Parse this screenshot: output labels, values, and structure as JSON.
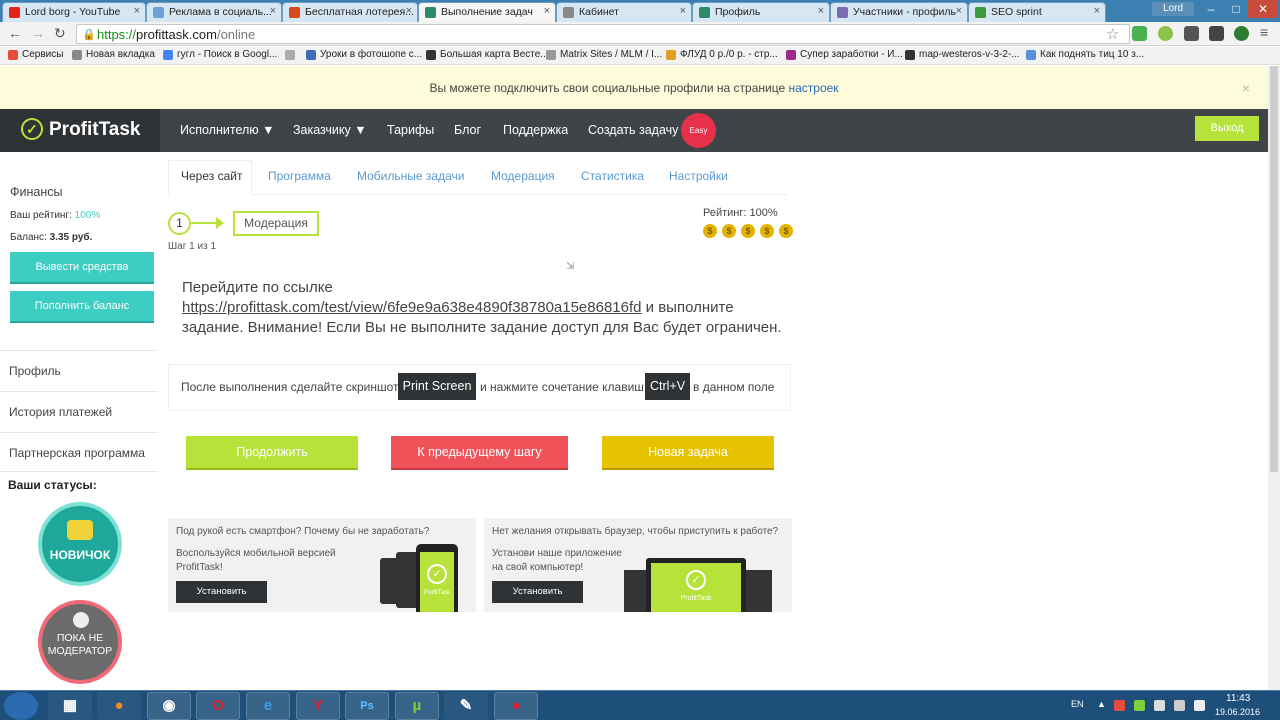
{
  "browser": {
    "tabs": [
      {
        "title": "Lord borg - YouTube",
        "color": "#e62117"
      },
      {
        "title": "Реклама в социаль...",
        "color": "#6aa1d6"
      },
      {
        "title": "Бесплатная лотерея...",
        "color": "#d84a1b"
      },
      {
        "title": "Выполнение задач",
        "color": "#2c8a6a"
      },
      {
        "title": "Кабинет",
        "color": "#888888"
      },
      {
        "title": "Профиль",
        "color": "#2c8a6a"
      },
      {
        "title": "Участники - профиль",
        "color": "#7a6bb2"
      },
      {
        "title": "SEO sprint",
        "color": "#3a9b3a"
      }
    ],
    "user_chip": "Lord",
    "url_scheme": "https://",
    "url_host": "profittask.com",
    "url_path": "/online",
    "bookmarks": [
      {
        "label": "Сервисы",
        "color": "#e74c3c"
      },
      {
        "label": "Новая вкладка",
        "color": "#888888"
      },
      {
        "label": "гугл - Поиск в Googl...",
        "color": "#4285f4"
      },
      {
        "label": "",
        "color": "#aaaaaa"
      },
      {
        "label": "Уроки в фотошопе с...",
        "color": "#3b6cb5"
      },
      {
        "label": "Большая карта Весте...",
        "color": "#333333"
      },
      {
        "label": "Matrix Sites / MLM / I...",
        "color": "#999999"
      },
      {
        "label": "ФЛУД 0 р./0 р. - стр...",
        "color": "#e0a020"
      },
      {
        "label": "Супер заработки - И...",
        "color": "#9b2c8b"
      },
      {
        "label": "map-westeros-v-3-2-...",
        "color": "#333333"
      },
      {
        "label": "Как поднять тиц 10 з...",
        "color": "#5b8fd8"
      }
    ]
  },
  "notice": {
    "text": "Вы можете подключить свои социальные профили на странице",
    "link": "настроек",
    "close": "×"
  },
  "nav": {
    "logo": "ProfitTask",
    "logo_mark": "✓",
    "items": [
      "Исполнителю ▼",
      "Заказчику ▼",
      "Тарифы",
      "Блог",
      "Поддержка",
      "Создать задачу"
    ],
    "badge": "Easy",
    "logout": "Выход"
  },
  "sidebar": {
    "finance_title": "Финансы",
    "rating_label": "Ваш рейтинг:",
    "rating_value": "100%",
    "balance_label": "Баланс:",
    "balance_value": "3.35 руб.",
    "withdraw": "Вывести средства",
    "topup": "Пополнить баланс",
    "links": [
      "Профиль",
      "История платежей",
      "Партнерская программа"
    ],
    "statuses_title": "Ваши статусы:",
    "status1": "НОВИЧОК",
    "status2": "ПОКА НЕ МОДЕРАТОР"
  },
  "content": {
    "tabs": [
      "Через сайт",
      "Программа",
      "Мобильные задачи",
      "Модерация",
      "Статистика",
      "Настройки"
    ],
    "step_number": "1",
    "step_box": "Модерация",
    "step_caption": "Шаг 1 из 1",
    "rating": "Рейтинг: 100%",
    "coin_symbol": "$",
    "coin_count": 5,
    "instr_intro": "Перейдите по ссылке",
    "instr_link": "https://profittask.com/test/view/6fe9e9a638e4890f38780a15e86816fd",
    "instr_mid": "и выполните",
    "instr_end": "задание. Внимание! Если Вы не выполните задание доступ для Вас будет ограничен.",
    "paste_a": "После выполнения сделайте скриншот",
    "key1": "Print Screen",
    "paste_b": "и нажмите сочетание клавиш",
    "key2": "Ctrl+V",
    "paste_c": "в данном поле",
    "btn_continue": "Продолжить",
    "btn_prev": "К предыдущему шагу",
    "btn_new": "Новая задача",
    "promo1_title": "Под рукой есть смартфон? Почему бы не заработать?",
    "promo1_line1": "Воспользуйся мобильной версией",
    "promo1_line2": "ProfitTask!",
    "promo1_btn": "Установить",
    "promo2_title": "Нет желания открывать браузер, чтобы приступить к работе?",
    "promo2_line1": "Установи наше приложение",
    "promo2_line2": "на свой компьютер!",
    "promo2_btn": "Установить",
    "device_brand": "ProfitTask"
  },
  "taskbar": {
    "lang": "EN",
    "time": "11:43",
    "date": "19.06.2016"
  },
  "colors": {
    "accent_green": "#b7e23a",
    "teal": "#3dcdc2",
    "red": "#f0525a",
    "yellow": "#e6c300",
    "dark": "#3f4448"
  }
}
